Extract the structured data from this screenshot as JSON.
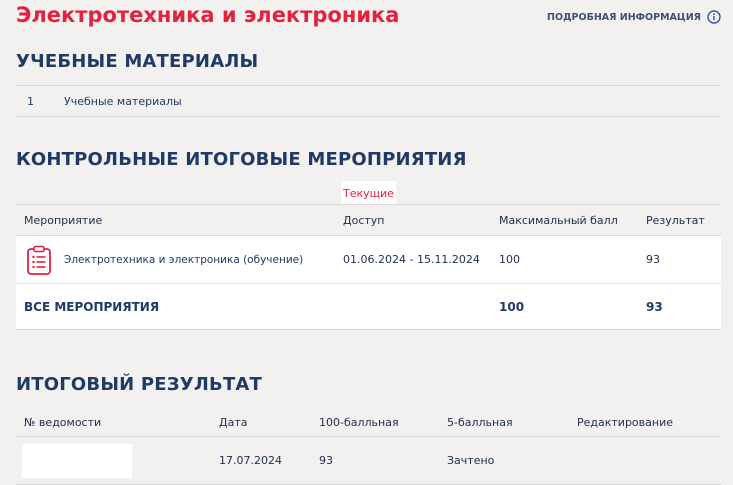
{
  "header": {
    "title": "Электротехника и электроника",
    "info_link": "ПОДРОБНАЯ ИНФОРМАЦИЯ"
  },
  "materials": {
    "title": "УЧЕБНЫЕ МАТЕРИАЛЫ",
    "items": [
      {
        "num": "1",
        "label": "Учебные материалы"
      }
    ]
  },
  "events": {
    "title": "КОНТРОЛЬНЫЕ ИТОГОВЫЕ МЕРОПРИЯТИЯ",
    "tab": "Текущие",
    "columns": [
      "Мероприятие",
      "Доступ",
      "Максимальный балл",
      "Результат"
    ],
    "rows": [
      {
        "name": "Электротехника и электроника (обучение)",
        "access": "01.06.2024 - 15.11.2024",
        "max": "100",
        "result": "93",
        "icon": "clipboard-icon"
      }
    ],
    "total": {
      "label": "ВСЕ МЕРОПРИЯТИЯ",
      "max": "100",
      "result": "93"
    }
  },
  "final": {
    "title": "ИТОГОВЫЙ РЕЗУЛЬТАТ",
    "columns": [
      "№ ведомости",
      "Дата",
      "100-балльная",
      "5-балльная",
      "Редактирование"
    ],
    "rows": [
      {
        "sheet": "",
        "date": "17.07.2024",
        "score100": "93",
        "score5": "Зачтено",
        "edit": ""
      }
    ]
  },
  "colors": {
    "accent": "#e2233f",
    "heading": "#1f3a66",
    "background": "#f2f1f0"
  }
}
